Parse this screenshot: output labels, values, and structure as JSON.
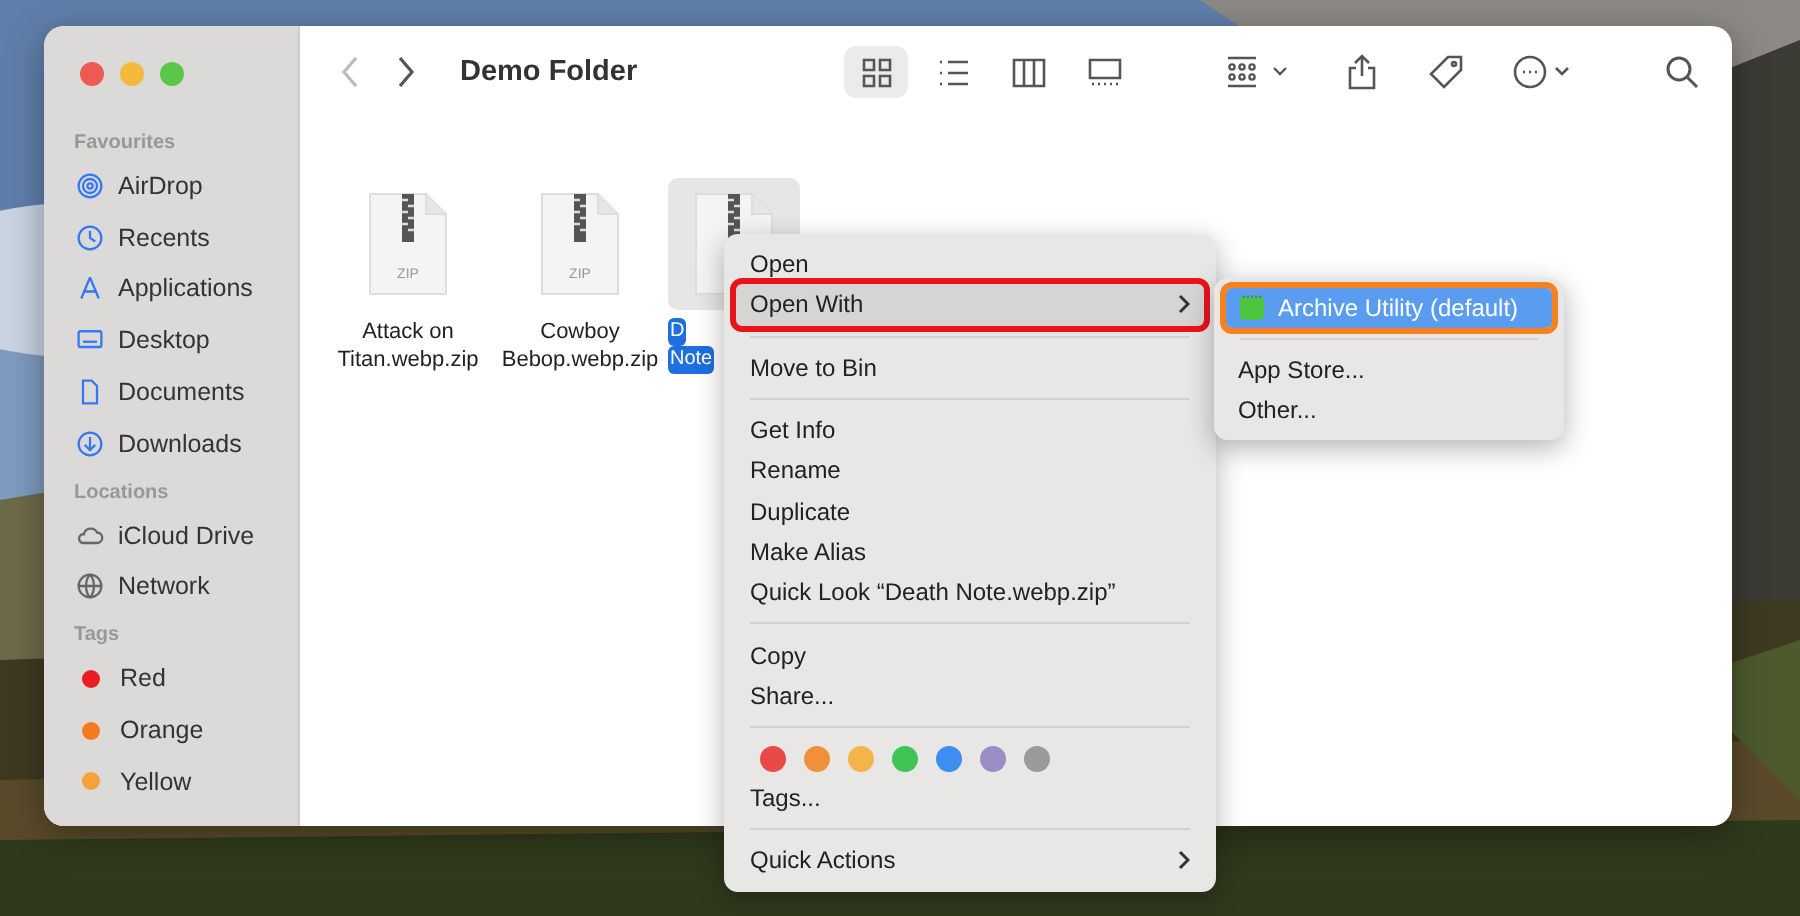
{
  "window": {
    "title": "Demo Folder"
  },
  "toolbar": {
    "views": [
      {
        "kind": "icons",
        "selected": true
      },
      {
        "kind": "list",
        "selected": false
      },
      {
        "kind": "columns",
        "selected": false
      },
      {
        "kind": "gallery",
        "selected": false
      }
    ]
  },
  "sidebar": {
    "sections": [
      {
        "heading": "Favourites",
        "items": [
          {
            "label": "AirDrop",
            "kind": "airdrop"
          },
          {
            "label": "Recents",
            "kind": "recents"
          },
          {
            "label": "Applications",
            "kind": "apps"
          },
          {
            "label": "Desktop",
            "kind": "desktop"
          },
          {
            "label": "Documents",
            "kind": "document"
          },
          {
            "label": "Downloads",
            "kind": "download"
          }
        ]
      },
      {
        "heading": "Locations",
        "items": [
          {
            "label": "iCloud Drive",
            "kind": "cloud"
          },
          {
            "label": "Network",
            "kind": "globe"
          }
        ]
      },
      {
        "heading": "Tags",
        "items": [
          {
            "label": "Red",
            "kind": "tag",
            "color": "#ec1c24"
          },
          {
            "label": "Orange",
            "kind": "tag",
            "color": "#f57a1f"
          },
          {
            "label": "Yellow",
            "kind": "tag",
            "color": "#f6a23c"
          }
        ]
      }
    ]
  },
  "files": [
    {
      "name": [
        "Attack on",
        "Titan.webp.zip"
      ],
      "icon_text": "ZIP",
      "selected": false
    },
    {
      "name": [
        "Cowboy",
        "Bebop.webp.zip"
      ],
      "icon_text": "ZIP",
      "selected": false
    },
    {
      "name": [
        "D",
        "Note"
      ],
      "selected": true
    }
  ],
  "context_menu": {
    "groups": [
      [
        {
          "label": "Open",
          "kind": "item",
          "selected": false,
          "boxed": false,
          "submenu": false
        },
        {
          "label": "Open With",
          "kind": "item",
          "selected": true,
          "boxed": true,
          "submenu": true
        }
      ],
      [
        {
          "label": "Move to Bin",
          "kind": "item",
          "selected": false,
          "boxed": false,
          "submenu": false
        }
      ],
      [
        {
          "label": "Get Info",
          "kind": "item",
          "selected": false,
          "boxed": false,
          "submenu": false
        },
        {
          "label": "Rename",
          "kind": "item",
          "selected": false,
          "boxed": false,
          "submenu": false
        },
        {
          "label": "Duplicate",
          "kind": "item",
          "selected": false,
          "boxed": false,
          "submenu": false
        },
        {
          "label": "Make Alias",
          "kind": "item",
          "selected": false,
          "boxed": false,
          "submenu": false
        },
        {
          "label": "Quick Look “Death Note.webp.zip”",
          "kind": "item",
          "selected": false,
          "boxed": false,
          "submenu": false
        }
      ],
      [
        {
          "label": "Copy",
          "kind": "item",
          "selected": false,
          "boxed": false,
          "submenu": false
        },
        {
          "label": "Share...",
          "kind": "item",
          "selected": false,
          "boxed": false,
          "submenu": false
        }
      ],
      [
        {
          "kind": "tags",
          "colors": [
            {
              "color": "#e84a4a"
            },
            {
              "color": "#f0913a"
            },
            {
              "color": "#f3b54a"
            },
            {
              "color": "#3fc553"
            },
            {
              "color": "#3d8ef0"
            },
            {
              "color": "#9a8dc6"
            },
            {
              "color": "#9a9a9a"
            }
          ]
        },
        {
          "label": "Tags...",
          "kind": "item",
          "selected": false,
          "boxed": false,
          "submenu": false
        }
      ],
      [
        {
          "label": "Quick Actions",
          "kind": "item",
          "selected": false,
          "boxed": false,
          "submenu": true
        }
      ]
    ]
  },
  "submenu": {
    "groups": [
      [
        {
          "label": "Archive Utility (default)",
          "app_icon": true,
          "selected": true,
          "boxed": true
        }
      ],
      [
        {
          "label": "App Store...",
          "app_icon": false,
          "selected": false,
          "boxed": false
        },
        {
          "label": "Other...",
          "app_icon": false,
          "selected": false,
          "boxed": false
        }
      ]
    ]
  }
}
